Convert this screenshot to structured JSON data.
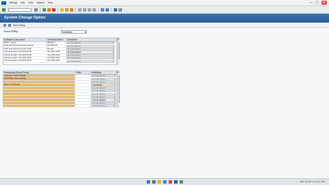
{
  "menubar": {
    "items": [
      "Settings",
      "Edit",
      "Goto",
      "System",
      "Help"
    ],
    "window_controls": [
      "—",
      "▢",
      "✕"
    ]
  },
  "app": {
    "title": "System Change Option",
    "toolbar_label": "Next Dialog"
  },
  "global_setting": {
    "label": "Global Setting",
    "value": "Modifiable"
  },
  "software_components": {
    "columns": [
      "Software Component",
      "Technical Name",
      "Modifiable"
    ],
    "rows": [
      {
        "component": "BUSI. Layers",
        "technical": "BBUSIT",
        "modifiable": "Not Modifiable"
      },
      {
        "component": "SAP Enterprise Extension Retail",
        "technical": "EA-RETAIL",
        "modifiable": "Not Modifiable"
      },
      {
        "component": "SAP Enterprise Extension HR",
        "technical": "EA-HR",
        "modifiable": "Not Modifiable"
      },
      {
        "component": "Instrumentation SS-ARCHIVE",
        "technical": "SA-ARCHIVE",
        "modifiable": "Not Modifiable"
      },
      {
        "component": "Instrumentation SS-ARCHIVE",
        "technical": "SA-ARCHIVE",
        "modifiable": "Not Modifiable"
      },
      {
        "component": "Instrumentation SS-ARCHIVE",
        "technical": "SA-ARCHIVE",
        "modifiable": "Not Modifiable"
      },
      {
        "component": "Instrumentation SS-ARCHIVE",
        "technical": "SA-ARCHIVE",
        "modifiable": "Not Modifiable"
      }
    ]
  },
  "namespaces": {
    "columns": [
      "Namespace/Name Range",
      "Prefix",
      "Modifiable"
    ],
    "rows": [
      {
        "name": "Customer Name Range",
        "prefix": "",
        "modifiable": "Not Modifiable"
      },
      {
        "name": "ABAP/BW Name Range",
        "prefix": "",
        "modifiable": "Not Modifiable"
      },
      {
        "name": "",
        "prefix": "",
        "modifiable": "Not Modifiable"
      },
      {
        "name": "BUSI. Ur Product",
        "prefix": "",
        "modifiable": "Modifiable"
      },
      {
        "name": "",
        "prefix": "",
        "modifiable": "Not Modifiable"
      },
      {
        "name": "",
        "prefix": "",
        "modifiable": "Not Modifiable"
      },
      {
        "name": "",
        "prefix": "",
        "modifiable": "Not Modifiable"
      },
      {
        "name": "",
        "prefix": "",
        "modifiable": "Not Modifiable"
      },
      {
        "name": "",
        "prefix": "",
        "modifiable": "Not Modifiable"
      },
      {
        "name": "",
        "prefix": "",
        "modifiable": "Not Modifiable"
      },
      {
        "name": "",
        "prefix": "",
        "modifiable": "Not Modifiable"
      }
    ]
  },
  "status": {
    "tray_text": "ABC (1) 010 ▾ | 10:24 | INS"
  },
  "colors": {
    "title_bar": "#2f63a0",
    "namespace_highlight": "#e2b872",
    "selected_cell": "#f9e9a6"
  }
}
